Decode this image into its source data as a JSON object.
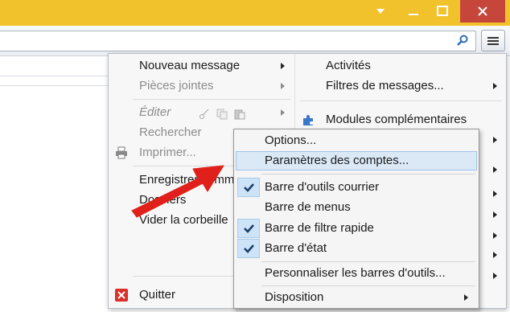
{
  "window": {
    "accent_color": "#f2c22d",
    "close_color": "#c7463c",
    "buttons": [
      "dropdown-icon",
      "minimize-icon",
      "maximize-icon",
      "close-icon"
    ]
  },
  "toolbar": {
    "search_placeholder": "",
    "search_icon": "search-icon",
    "menu_icon": "hamburger-menu-icon"
  },
  "menu_left": [
    {
      "label": "Nouveau message",
      "enabled": true,
      "submenu": true
    },
    {
      "label": "Pièces jointes",
      "enabled": false,
      "submenu": true
    },
    {
      "label": "Éditer",
      "enabled": false,
      "submenu": true
    },
    {
      "label": "Rechercher",
      "enabled": false,
      "submenu": false
    },
    {
      "label": "Imprimer...",
      "enabled": false,
      "submenu": false,
      "icon": "printer-icon"
    },
    {
      "label": "Enregistrer comme",
      "enabled": true,
      "submenu": true
    },
    {
      "label": "Dossiers",
      "enabled": true,
      "submenu": true
    },
    {
      "label": "Vider la corbeille",
      "enabled": true,
      "submenu": false
    },
    {
      "label": "Quitter",
      "enabled": true,
      "submenu": false,
      "icon": "quit-icon"
    }
  ],
  "menu_right": [
    {
      "label": "Activités",
      "submenu": false
    },
    {
      "label": "Filtres de messages...",
      "submenu": true
    },
    {
      "label": "Modules complémentaires",
      "submenu": false,
      "icon": "puzzle-icon"
    }
  ],
  "submenu": [
    {
      "label": "Options...",
      "checked": false,
      "highlighted": false,
      "submenu": false
    },
    {
      "label": "Paramètres des comptes...",
      "checked": false,
      "highlighted": true,
      "submenu": false
    },
    {
      "label": "Barre d'outils courrier",
      "checked": true,
      "highlighted": false,
      "submenu": false
    },
    {
      "label": "Barre de menus",
      "checked": false,
      "highlighted": false,
      "submenu": false
    },
    {
      "label": "Barre de filtre rapide",
      "checked": true,
      "highlighted": false,
      "submenu": false
    },
    {
      "label": "Barre d'état",
      "checked": true,
      "highlighted": false,
      "submenu": false
    },
    {
      "label": "Personnaliser les barres d'outils...",
      "checked": false,
      "highlighted": false,
      "submenu": false
    },
    {
      "label": "Disposition",
      "checked": false,
      "highlighted": false,
      "submenu": true
    }
  ],
  "annotation": {
    "color": "#e0201b",
    "icon": "red-arrow"
  }
}
